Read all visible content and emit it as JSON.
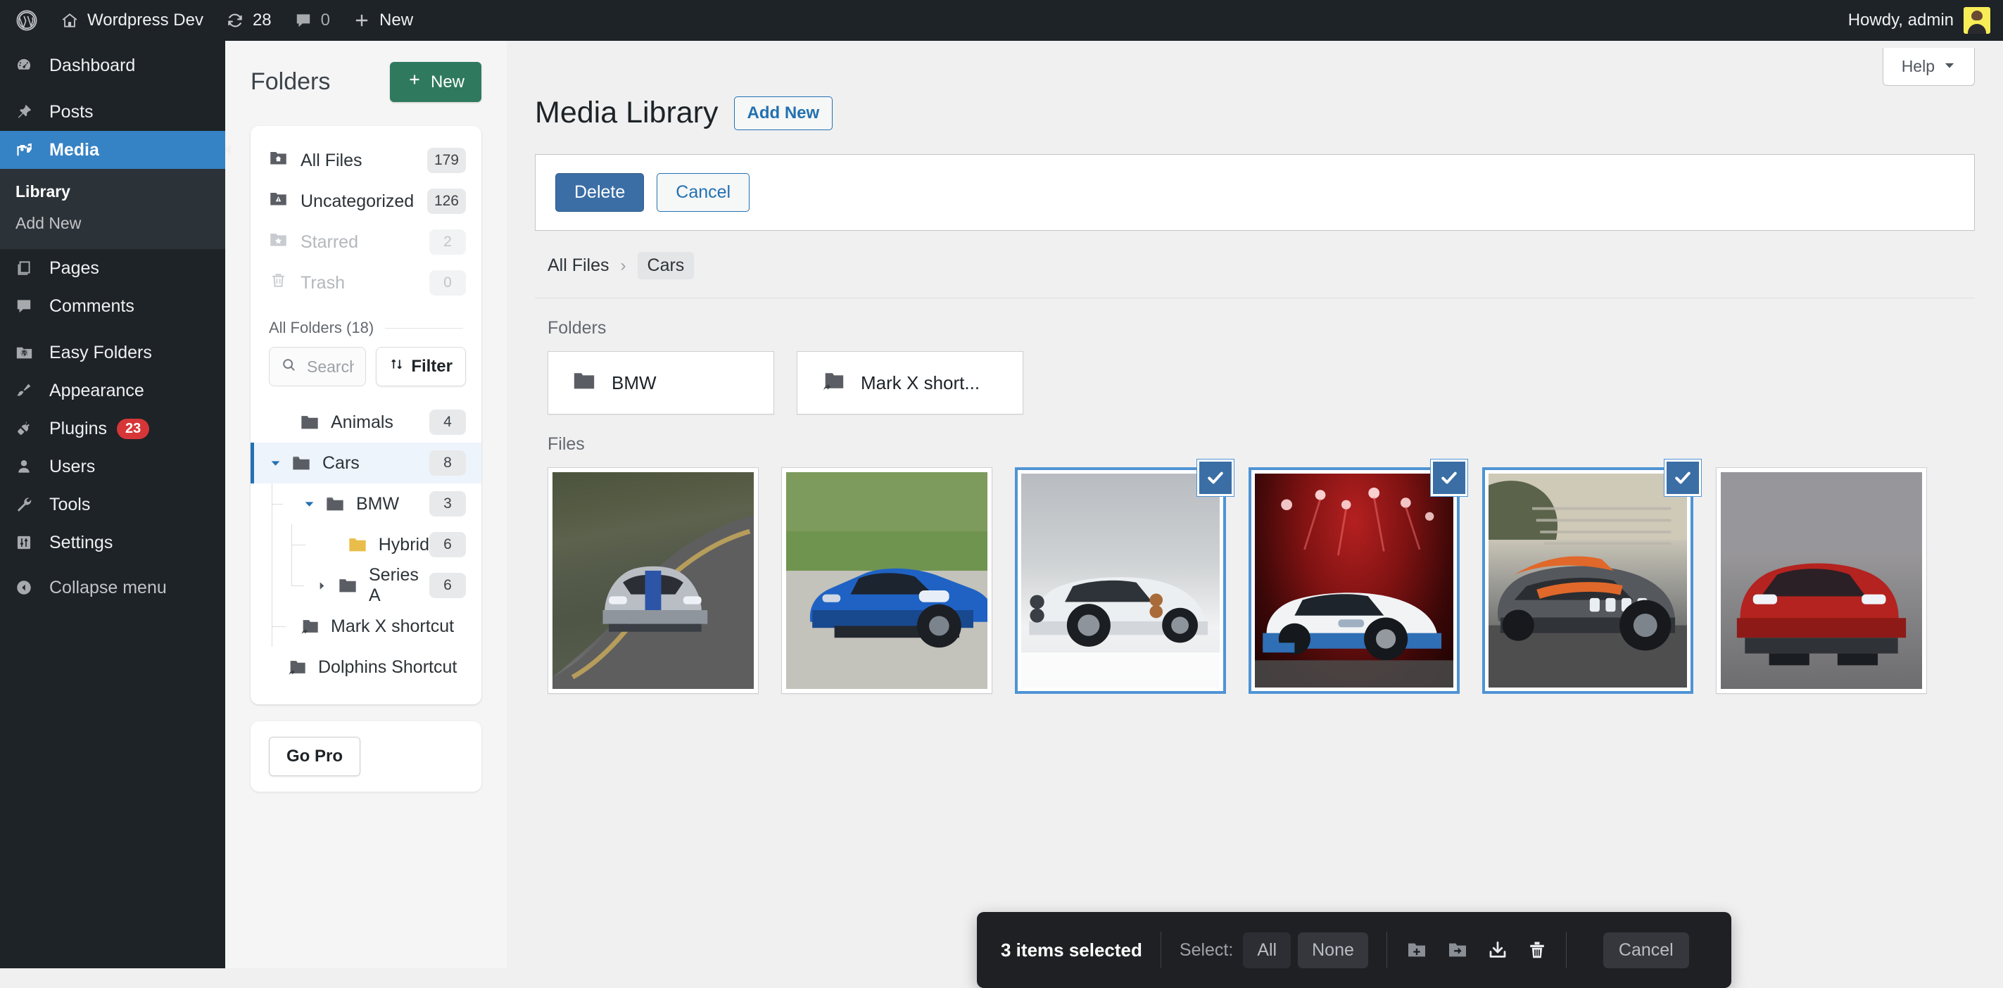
{
  "adminbar": {
    "logo_icon": "wordpress-logo-icon",
    "site_icon": "home-icon",
    "site_name": "Wordpress Dev",
    "updates_icon": "updates-icon",
    "updates_count": "28",
    "comments_icon": "comment-icon",
    "comments_count": "0",
    "new_icon": "plus-icon",
    "new_label": "New",
    "howdy": "Howdy, admin",
    "avatar_icon": "user-avatar"
  },
  "adminmenu": {
    "items": [
      {
        "label": "Dashboard",
        "icon": "dashboard-icon",
        "current": false
      },
      {
        "label": "Posts",
        "icon": "pin-icon",
        "current": false
      },
      {
        "label": "Media",
        "icon": "media-icon",
        "current": true
      },
      {
        "label": "Pages",
        "icon": "pages-icon",
        "current": false
      },
      {
        "label": "Comments",
        "icon": "comment-icon",
        "current": false
      },
      {
        "label": "Easy Folders",
        "icon": "folder-wp-icon",
        "current": false
      },
      {
        "label": "Appearance",
        "icon": "brush-icon",
        "current": false
      },
      {
        "label": "Plugins",
        "icon": "plug-icon",
        "current": false,
        "badge": "23"
      },
      {
        "label": "Users",
        "icon": "user-icon",
        "current": false
      },
      {
        "label": "Tools",
        "icon": "wrench-icon",
        "current": false
      },
      {
        "label": "Settings",
        "icon": "settings-icon",
        "current": false
      },
      {
        "label": "Collapse menu",
        "icon": "collapse-icon",
        "current": false
      }
    ],
    "media_submenu": [
      {
        "label": "Library",
        "current": true
      },
      {
        "label": "Add New",
        "current": false
      }
    ]
  },
  "folders_panel": {
    "title": "Folders",
    "new_button": {
      "label": "New",
      "icon": "plus-icon"
    },
    "system_folders": [
      {
        "label": "All Files",
        "count": "179",
        "icon": "folder-home-icon",
        "dim": false
      },
      {
        "label": "Uncategorized",
        "count": "126",
        "icon": "folder-warning-icon",
        "dim": false
      },
      {
        "label": "Starred",
        "count": "2",
        "icon": "folder-star-icon",
        "dim": true
      },
      {
        "label": "Trash",
        "count": "0",
        "icon": "trash-icon",
        "dim": true
      }
    ],
    "all_folders_label": "All Folders (18)",
    "search": {
      "placeholder": "Search folders...",
      "value": "",
      "icon": "search-icon"
    },
    "filter_button": {
      "label": "Filter",
      "icon": "sort-arrows-icon"
    },
    "tree": [
      {
        "label": "Animals",
        "count": "4",
        "depth": 0,
        "caret": "none",
        "icon": "folder-icon",
        "color": "#5a5e64",
        "active": false
      },
      {
        "label": "Cars",
        "count": "8",
        "depth": 0,
        "caret": "down",
        "icon": "folder-open-icon",
        "color": "#5a5e64",
        "active": true
      },
      {
        "label": "BMW",
        "count": "3",
        "depth": 1,
        "caret": "down",
        "icon": "folder-open-icon",
        "color": "#5a5e64",
        "active": false
      },
      {
        "label": "Hybrid",
        "count": "6",
        "depth": 2,
        "caret": "none",
        "icon": "folder-icon",
        "color": "#e8bd4a",
        "active": false
      },
      {
        "label": "Series A",
        "count": "6",
        "depth": 2,
        "caret": "right",
        "icon": "folder-icon",
        "color": "#5a5e64",
        "active": false
      },
      {
        "label": "Mark X shortcut",
        "count": "",
        "depth": 1,
        "caret": "none",
        "icon": "folder-shortcut-icon",
        "color": "#5a5e64",
        "active": false
      },
      {
        "label": "Dolphins Shortcut",
        "count": "",
        "depth": 0,
        "caret": "none",
        "icon": "folder-shortcut-icon",
        "color": "#5a5e64",
        "active": false
      }
    ],
    "go_pro_button": "Go Pro"
  },
  "main": {
    "help_button": {
      "label": "Help",
      "icon": "chevron-down-icon"
    },
    "page_title": "Media Library",
    "add_new_button": "Add New",
    "actions": {
      "delete": "Delete",
      "cancel": "Cancel"
    },
    "breadcrumb": {
      "root": "All Files",
      "separator": "›",
      "current": "Cars"
    },
    "folders_section_label": "Folders",
    "folder_cards": [
      {
        "label": "BMW",
        "icon": "folder-icon"
      },
      {
        "label": "Mark X short...",
        "icon": "folder-shortcut-icon"
      }
    ],
    "files_section_label": "Files",
    "files": [
      {
        "alt": "Silver Corvette with blue stripe on a forest road",
        "selected": false
      },
      {
        "alt": "Blue Maserati MC20 on a country road",
        "selected": false
      },
      {
        "alt": "White Pagani Zonda rear three quarter in studio",
        "selected": true
      },
      {
        "alt": "White Bugatti Divo on stage with red lights",
        "selected": true
      },
      {
        "alt": "Grey and orange Bugatti Chiron on a racetrack",
        "selected": true
      },
      {
        "alt": "Red Corvette front view",
        "selected": false
      }
    ]
  },
  "select_toolbar": {
    "count_label": "3 items selected",
    "select_label": "Select:",
    "all_button": "All",
    "none_button": "None",
    "icons": [
      {
        "name": "move-to-folder-icon"
      },
      {
        "name": "copy-to-folder-icon"
      },
      {
        "name": "download-icon"
      },
      {
        "name": "delete-icon"
      }
    ],
    "cancel_button": "Cancel"
  },
  "colors": {
    "admin_dark": "#1d2327",
    "accent_blue": "#3582c4",
    "link_blue": "#2271b1",
    "green": "#2f7a5e",
    "badge_red": "#d63638",
    "selection_blue": "#4f94d4",
    "hybrid_yellow": "#e8bd4a"
  }
}
